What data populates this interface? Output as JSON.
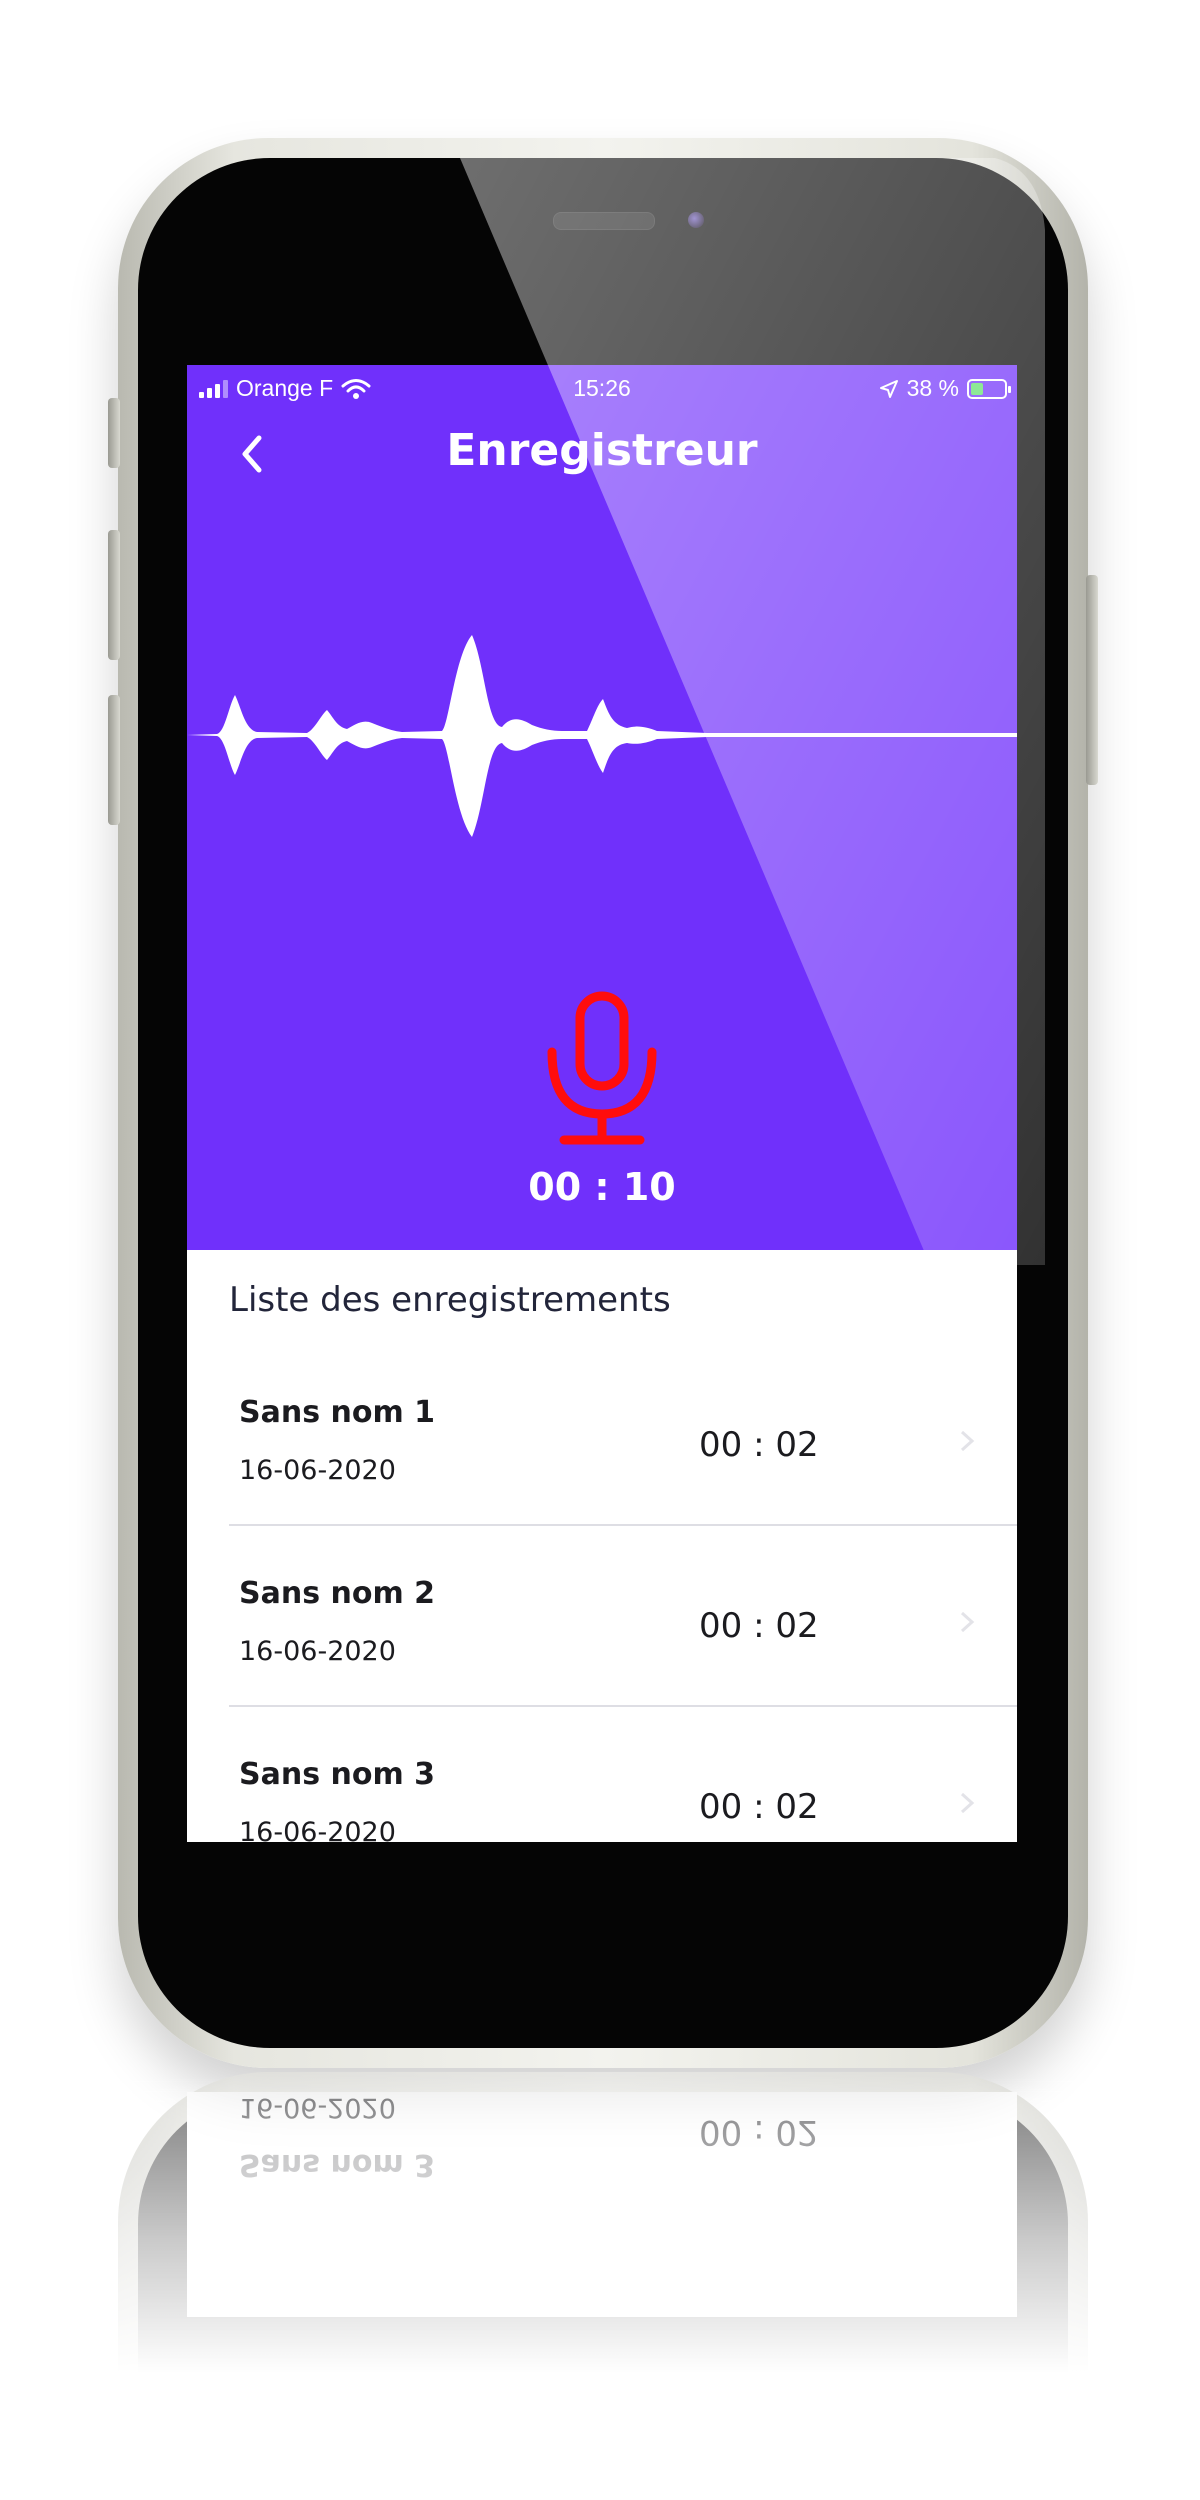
{
  "status_bar": {
    "carrier": "Orange F",
    "time": "15:26",
    "battery": "38 %",
    "battery_level": 0.38
  },
  "nav": {
    "title": "Enregistreur"
  },
  "recorder": {
    "timer": "00 : 10",
    "mic_color": "#ff0d0d"
  },
  "colors": {
    "accent": "#7030fb",
    "text": "#1b1b1f"
  },
  "list": {
    "title": "Liste des enregistrements",
    "items": [
      {
        "name": "Sans nom 1",
        "date": "16-06-2020",
        "duration": "00 : 02"
      },
      {
        "name": "Sans nom 2",
        "date": "16-06-2020",
        "duration": "00 : 02"
      },
      {
        "name": "Sans nom 3",
        "date": "16-06-2020",
        "duration": "00 : 02"
      }
    ]
  }
}
